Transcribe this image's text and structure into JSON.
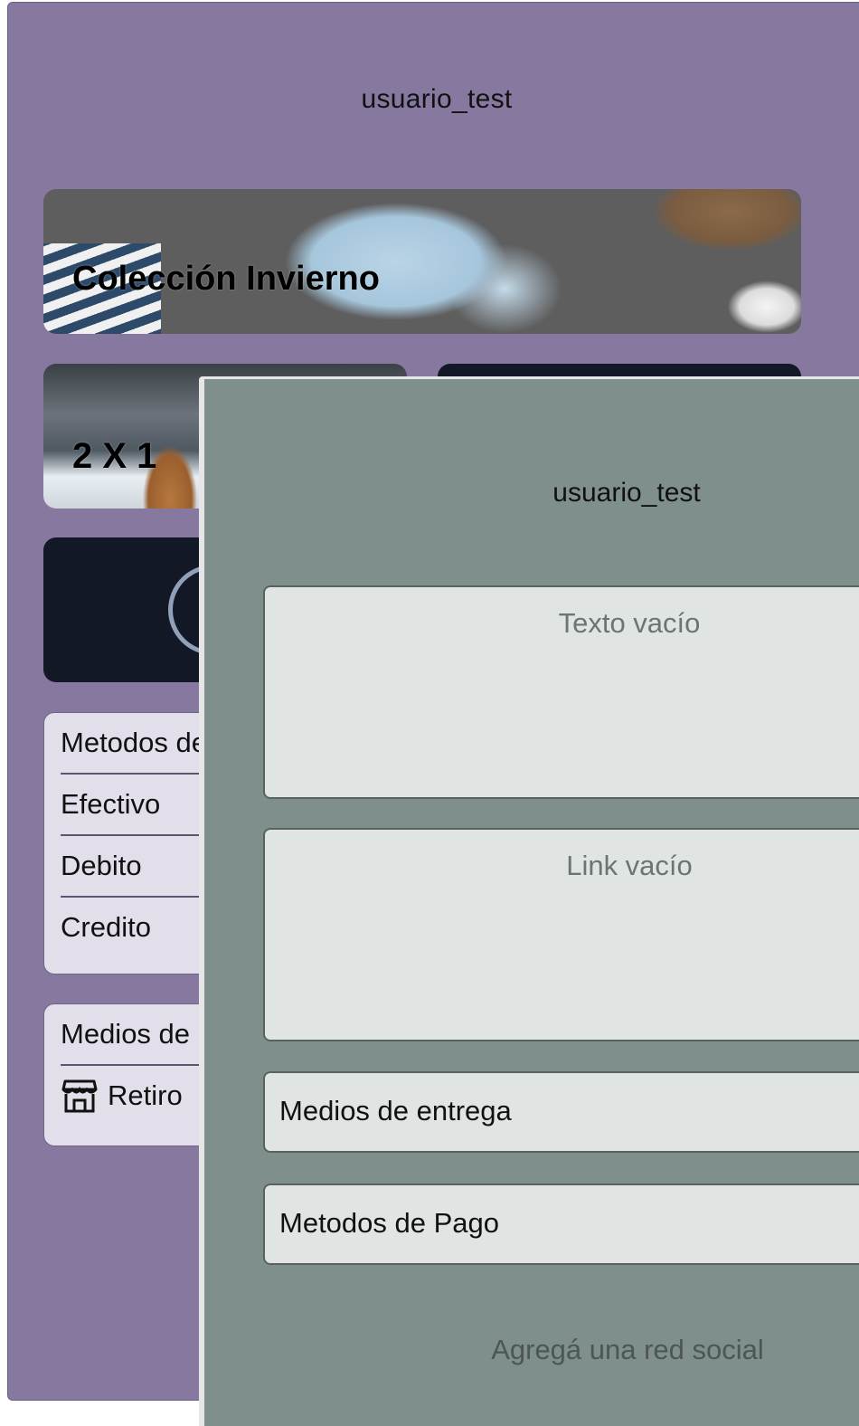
{
  "back_panel": {
    "username": "usuario_test",
    "banners": [
      {
        "title": "Colección Invierno"
      },
      {
        "title": "2 X 1"
      }
    ],
    "payment_methods": {
      "header": "Metodos de Pago",
      "items": [
        "Efectivo",
        "Debito",
        "Credito"
      ]
    },
    "delivery": {
      "header": "Medios de entrega",
      "items": [
        {
          "label": "Retiro",
          "icon": "store-icon"
        }
      ]
    }
  },
  "front_panel": {
    "username": "usuario_test",
    "text_placeholder": "Texto vacío",
    "link_placeholder": "Link vacío",
    "delivery_button": "Medios de entrega",
    "payment_button": "Metodos de Pago",
    "add_social": "Agregá una red social"
  },
  "colors": {
    "back_background": "#8778a0",
    "front_background": "#7e8f8c",
    "card_dark": "#121826"
  }
}
